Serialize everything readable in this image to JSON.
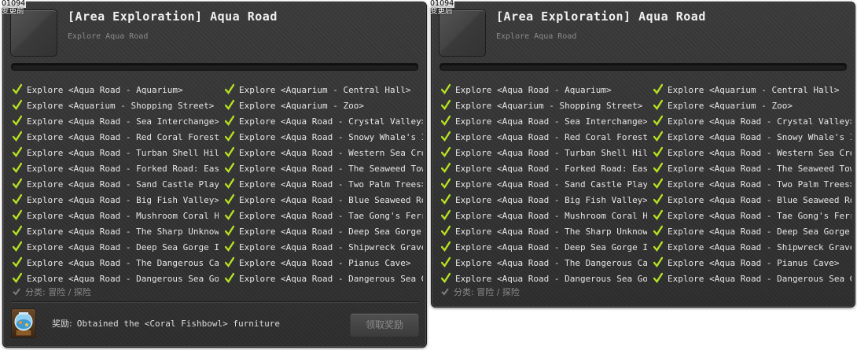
{
  "panels": [
    {
      "id_label": "01094",
      "sub_label": "变更前",
      "title": "[Area Exploration] Aqua Road",
      "subtitle": "Explore Aqua Road",
      "progress": 0,
      "left_column": [
        "Explore <Aqua Road - Aquarium>",
        "Explore <Aquarium - Shopping Street>",
        "Explore <Aqua Road - Sea Interchange>",
        "Explore <Aqua Road - Red Coral Forest>",
        "Explore <Aqua Road - Turban Shell Hill>",
        "Explore <Aqua Road - Forked Road: Eas..",
        "Explore <Aqua Road - Sand Castle Play..",
        "Explore <Aqua Road - Big Fish Valley>",
        "Explore <Aqua Road - Mushroom Coral H..",
        "Explore <Aqua Road - The Sharp Unknown>",
        "Explore <Aqua Road - Deep Sea Gorge II>",
        "Explore <Aqua Road - The Dangerous Ca..",
        "Explore <Aqua Road - Dangerous Sea Go.."
      ],
      "right_column": [
        "Explore <Aquarium - Central Hall>",
        "Explore <Aquarium - Zoo>",
        "Explore <Aqua Road - Crystal Valley>",
        "Explore <Aqua Road - Snowy Whale's Is..",
        "Explore <Aqua Road - Western Sea Cros..",
        "Explore <Aqua Road - The Seaweed Tower>",
        "Explore <Aqua Road - Two Palm Trees>",
        "Explore <Aqua Road - Blue Seaweed Road>",
        "Explore <Aqua Road - Tae Gong's Ferry>",
        "Explore <Aqua Road - Deep Sea Gorge I>",
        "Explore <Aqua Road - Shipwreck Grave>",
        "Explore <Aqua Road - Pianus Cave>",
        "Explore <Aqua Road - Dangerous Sea Go.."
      ],
      "category": "分类: 冒险 / 探险",
      "reward_label": "奖励:",
      "reward_text": "Obtained the <Coral Fishbowl> furniture",
      "claim_button": "领取奖励"
    },
    {
      "id_label": "01094",
      "sub_label": "变更后",
      "title": "[Area Exploration] Aqua Road",
      "subtitle": "Explore Aqua Road",
      "progress": 0,
      "left_column": [
        "Explore <Aqua Road - Aquarium>",
        "Explore <Aquarium - Shopping Street>",
        "Explore <Aqua Road - Sea Interchange>",
        "Explore <Aqua Road - Red Coral Forest>",
        "Explore <Aqua Road - Turban Shell Hill>",
        "Explore <Aqua Road - Forked Road: Eas..",
        "Explore <Aqua Road - Sand Castle Play..",
        "Explore <Aqua Road - Big Fish Valley>",
        "Explore <Aqua Road - Mushroom Coral H..",
        "Explore <Aqua Road - The Sharp Unknown>",
        "Explore <Aqua Road - Deep Sea Gorge II>",
        "Explore <Aqua Road - The Dangerous Ca..",
        "Explore <Aqua Road - Dangerous Sea Go.."
      ],
      "right_column": [
        "Explore <Aquarium - Central Hall>",
        "Explore <Aquarium - Zoo>",
        "Explore <Aqua Road - Crystal Valley>",
        "Explore <Aqua Road - Snowy Whale's Is..",
        "Explore <Aqua Road - Western Sea Cros..",
        "Explore <Aqua Road - The Seaweed Tower>",
        "Explore <Aqua Road - Two Palm Trees>",
        "Explore <Aqua Road - Blue Seaweed Road>",
        "Explore <Aqua Road - Tae Gong's Ferry>",
        "Explore <Aqua Road - Deep Sea Gorge I>",
        "Explore <Aqua Road - Shipwreck Grave>",
        "Explore <Aqua Road - Pianus Cave>",
        "Explore <Aqua Road - Dangerous Sea Go.."
      ],
      "category": "分类: 冒险 / 探险"
    }
  ],
  "icons": {
    "check": "checkmark-icon",
    "category_check": "checkmark-icon",
    "reward": "fishbowl-icon"
  },
  "colors": {
    "check": "#b6e021",
    "panel_bg": "#333333",
    "progress_fill": "#4a90d2"
  }
}
